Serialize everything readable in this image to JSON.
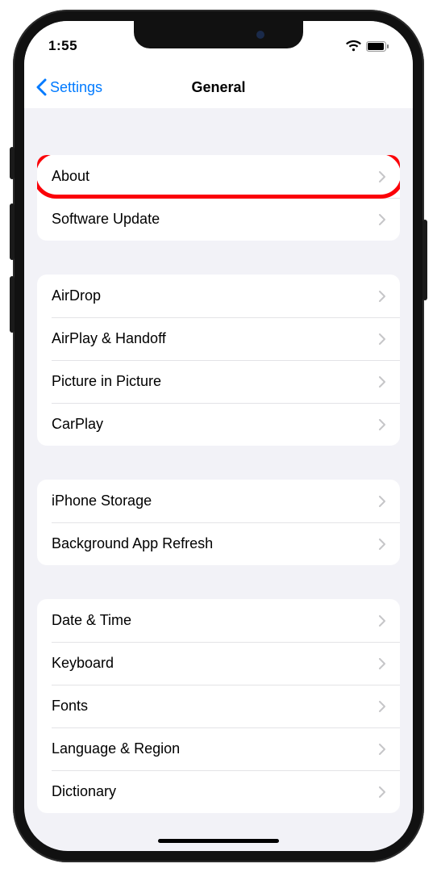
{
  "status": {
    "time": "1:55"
  },
  "nav": {
    "back": "Settings",
    "title": "General"
  },
  "groups": {
    "g0": {
      "r0": "About",
      "r1": "Software Update"
    },
    "g1": {
      "r0": "AirDrop",
      "r1": "AirPlay & Handoff",
      "r2": "Picture in Picture",
      "r3": "CarPlay"
    },
    "g2": {
      "r0": "iPhone Storage",
      "r1": "Background App Refresh"
    },
    "g3": {
      "r0": "Date & Time",
      "r1": "Keyboard",
      "r2": "Fonts",
      "r3": "Language & Region",
      "r4": "Dictionary"
    }
  }
}
